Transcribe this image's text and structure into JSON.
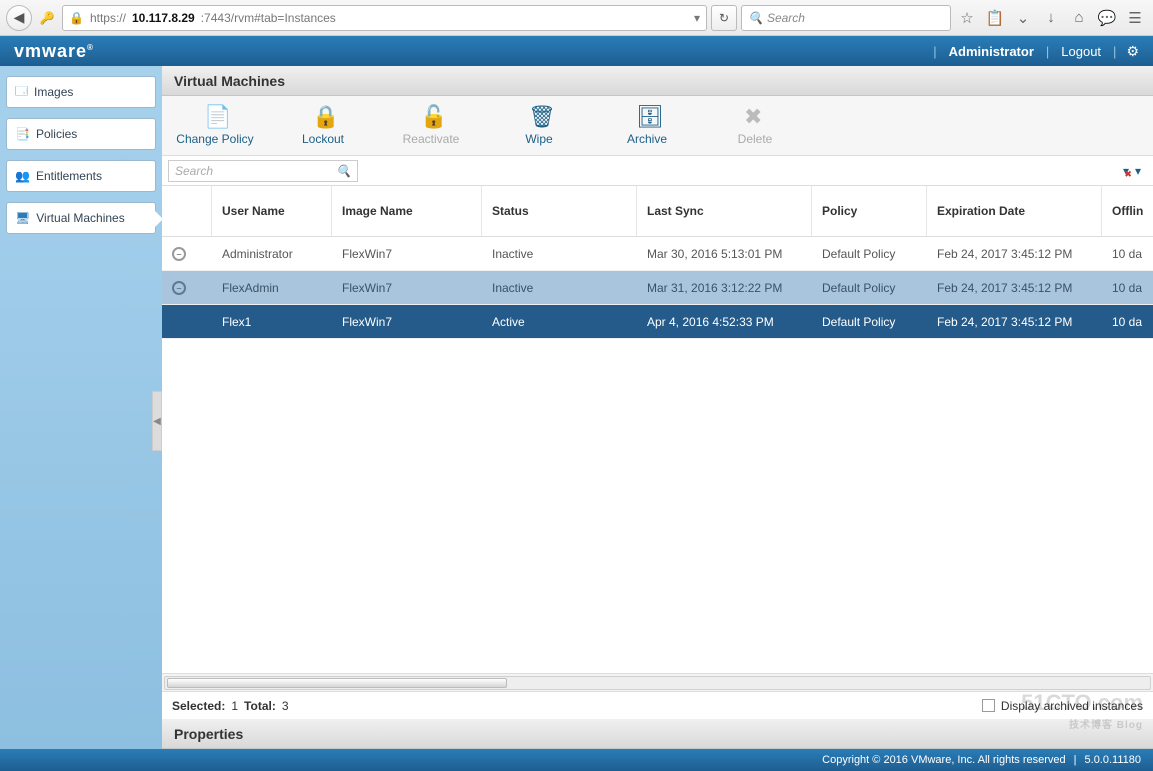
{
  "browser": {
    "url_scheme": "https://",
    "url_host": "10.117.8.29",
    "url_path": ":7443/rvm#tab=Instances",
    "search_placeholder": "Search"
  },
  "topbar": {
    "logo": "vmware",
    "user": "Administrator",
    "logout": "Logout"
  },
  "sidebar": {
    "items": [
      {
        "label": "Images"
      },
      {
        "label": "Policies"
      },
      {
        "label": "Entitlements"
      },
      {
        "label": "Virtual Machines"
      }
    ]
  },
  "panel": {
    "title": "Virtual Machines"
  },
  "toolbar": {
    "change_policy": "Change Policy",
    "lockout": "Lockout",
    "reactivate": "Reactivate",
    "wipe": "Wipe",
    "archive": "Archive",
    "delete": "Delete"
  },
  "search": {
    "placeholder": "Search"
  },
  "columns": {
    "user": "User Name",
    "image": "Image Name",
    "status": "Status",
    "sync": "Last Sync",
    "policy": "Policy",
    "exp": "Expiration Date",
    "off": "Offlin"
  },
  "rows": [
    {
      "user": "Administrator",
      "image": "FlexWin7",
      "status": "Inactive",
      "sync": "Mar 30, 2016 5:13:01 PM",
      "policy": "Default Policy",
      "exp": "Feb 24, 2017 3:45:12 PM",
      "off": "10 da"
    },
    {
      "user": "FlexAdmin",
      "image": "FlexWin7",
      "status": "Inactive",
      "sync": "Mar 31, 2016 3:12:22 PM",
      "policy": "Default Policy",
      "exp": "Feb 24, 2017 3:45:12 PM",
      "off": "10 da"
    },
    {
      "user": "Flex1",
      "image": "FlexWin7",
      "status": "Active",
      "sync": "Apr 4, 2016 4:52:33 PM",
      "policy": "Default Policy",
      "exp": "Feb 24, 2017 3:45:12 PM",
      "off": "10 da"
    }
  ],
  "statusbar": {
    "selected_label": "Selected:",
    "selected_value": "1",
    "total_label": "Total:",
    "total_value": "3",
    "archived_label": "Display archived instances"
  },
  "properties": {
    "title": "Properties"
  },
  "footer": {
    "copyright": "Copyright © 2016 VMware, Inc. All rights reserved",
    "version": "5.0.0.11180"
  },
  "watermark": {
    "line1": "51CTO.com",
    "line2": "技术博客  Blog"
  }
}
